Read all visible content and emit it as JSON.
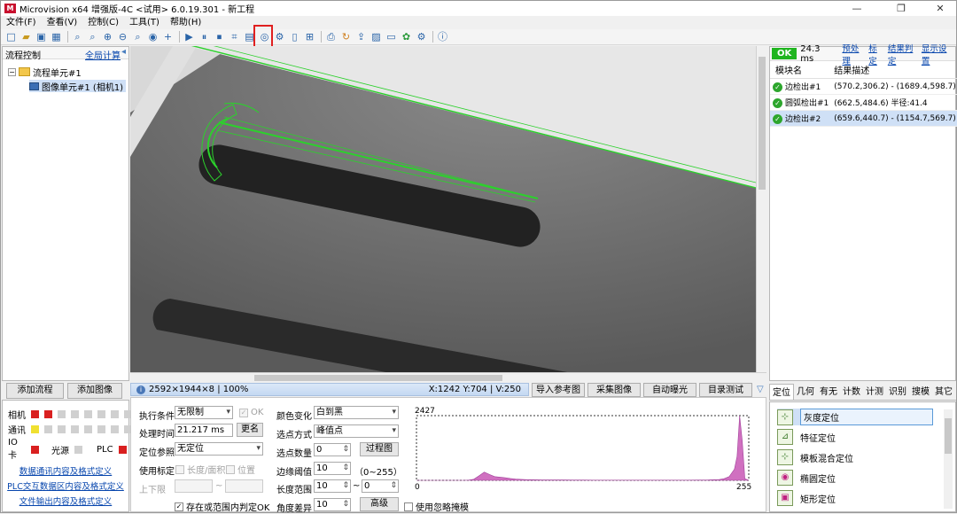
{
  "window": {
    "title": "Microvision x64 增强版-4C <试用> 6.0.19.301 - 新工程",
    "logo_letter": "M",
    "minimize": "—",
    "maximize": "❐",
    "close": "✕"
  },
  "menu": [
    "文件(F)",
    "查看(V)",
    "控制(C)",
    "工具(T)",
    "帮助(H)"
  ],
  "left_panel": {
    "title": "流程控制",
    "link": "全局计算",
    "pin": "◂",
    "tree_root": "流程单元#1",
    "tree_child": "图像单元#1 (相机1)",
    "expander": "−"
  },
  "left_buttons": {
    "add_flow": "添加流程",
    "add_image": "添加图像"
  },
  "io": {
    "camera": "相机",
    "comm": "通讯",
    "io_card": "IO卡",
    "light": "光源",
    "plc": "PLC"
  },
  "left_links": [
    "数据通讯内容及格式定义",
    "PLC交互数据区内容及格式定义",
    "文件输出内容及格式定义"
  ],
  "status": {
    "info": "2592×1944×8 | 100%",
    "coords": "X:1242 Y:704 | V:250",
    "info_glyph": "i"
  },
  "image_buttons": [
    "导入参考图",
    "采集图像",
    "自动曝光",
    "目录测试"
  ],
  "collapse": "▽",
  "result_panel": {
    "status": "OK",
    "time": "24.3 ms",
    "links": [
      "预处理",
      "标定",
      "结果判定",
      "显示设置"
    ],
    "col_module": "模块名",
    "col_result": "结果描述",
    "rows": [
      {
        "name": "边检出#1",
        "desc": "(570.2,306.2) - (1689.4,598.7)"
      },
      {
        "name": "圆弧检出#1",
        "desc": "(662.5,484.6) 半径:41.4"
      },
      {
        "name": "边检出#2",
        "desc": "(659.6,440.7) - (1154.7,569.7)"
      }
    ]
  },
  "params": {
    "exec_cond_label": "执行条件",
    "exec_cond": "无限制",
    "ok_cb": "OK",
    "proc_time_label": "处理时间",
    "proc_time": "21.217 ms",
    "rename": "更名",
    "loc_ref_label": "定位参照",
    "loc_ref": "无定位",
    "use_cal_label": "使用标定",
    "len_area": "长度/面积",
    "pos": "位置",
    "limits_label": "上下限",
    "tilde": "~",
    "exist_cb": "存在或范围内判定OK",
    "color_change_label": "颜色变化",
    "color_change": "白到黑",
    "select_mode_label": "选点方式",
    "select_mode": "峰值点",
    "select_count_label": "选点数量",
    "select_count": "0",
    "process_chart": "过程图",
    "edge_thresh_label": "边缘阈值",
    "edge_thresh": "10",
    "edge_range": "（0~255）",
    "length_range_label": "长度范围",
    "length_min": "10",
    "length_max": "0",
    "angle_diff_label": "角度差异",
    "angle_diff": "10",
    "advanced": "高级",
    "ignore_mask": "使用忽略掩模"
  },
  "chart_data": {
    "type": "area",
    "title": "",
    "ymax_label": "2427",
    "xlim": [
      0,
      255
    ],
    "x_ticks": [
      "0",
      "255"
    ],
    "x": [
      0,
      8,
      16,
      24,
      32,
      36,
      40,
      44,
      48,
      52,
      56,
      60,
      64,
      68,
      72,
      76,
      80,
      84,
      88,
      96,
      104,
      112,
      120,
      128,
      136,
      144,
      152,
      160,
      168,
      176,
      184,
      192,
      200,
      208,
      216,
      224,
      232,
      236,
      240,
      244,
      246,
      248,
      250,
      252,
      255
    ],
    "y": [
      0,
      0,
      0,
      0,
      0,
      0,
      8,
      40,
      170,
      310,
      220,
      140,
      120,
      95,
      70,
      50,
      36,
      28,
      22,
      18,
      14,
      12,
      10,
      9,
      8,
      7,
      7,
      6,
      6,
      6,
      6,
      6,
      7,
      8,
      10,
      14,
      28,
      60,
      140,
      420,
      900,
      2427,
      1500,
      60,
      0
    ]
  },
  "tool_tabs": [
    "定位",
    "几何",
    "有无",
    "计数",
    "计测",
    "识别",
    "搜模",
    "其它"
  ],
  "tools": [
    "灰度定位",
    "特征定位",
    "模板混合定位",
    "椭圆定位",
    "矩形定位"
  ]
}
